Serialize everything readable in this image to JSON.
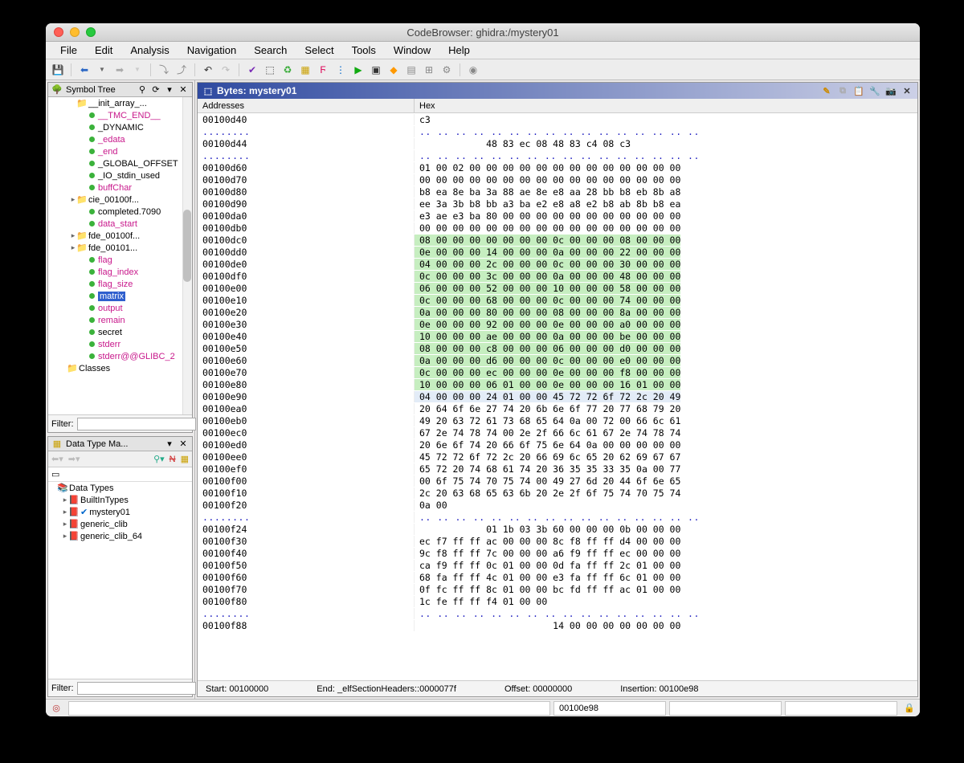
{
  "title": "CodeBrowser: ghidra:/mystery01",
  "menus": [
    "File",
    "Edit",
    "Analysis",
    "Navigation",
    "Search",
    "Select",
    "Tools",
    "Window",
    "Help"
  ],
  "symbol_tree": {
    "title": "Symbol Tree",
    "items": [
      {
        "type": "folder",
        "label": "__init_array_...",
        "indent": 2
      },
      {
        "type": "sym",
        "label": "__TMC_END__",
        "indent": 3,
        "style": "magenta"
      },
      {
        "type": "sym",
        "label": "_DYNAMIC",
        "indent": 3
      },
      {
        "type": "sym",
        "label": "_edata",
        "indent": 3,
        "style": "magenta"
      },
      {
        "type": "sym",
        "label": "_end",
        "indent": 3,
        "style": "magenta"
      },
      {
        "type": "sym",
        "label": "_GLOBAL_OFFSET",
        "indent": 3
      },
      {
        "type": "sym",
        "label": "_IO_stdin_used",
        "indent": 3
      },
      {
        "type": "sym",
        "label": "buffChar",
        "indent": 3,
        "style": "magenta"
      },
      {
        "type": "folder",
        "label": "cie_00100f...",
        "indent": 2,
        "exp": true
      },
      {
        "type": "sym",
        "label": "completed.7090",
        "indent": 3
      },
      {
        "type": "sym",
        "label": "data_start",
        "indent": 3,
        "style": "magenta"
      },
      {
        "type": "folder",
        "label": "fde_00100f...",
        "indent": 2,
        "exp": true
      },
      {
        "type": "folder",
        "label": "fde_00101...",
        "indent": 2,
        "exp": true
      },
      {
        "type": "sym",
        "label": "flag",
        "indent": 3,
        "style": "magenta"
      },
      {
        "type": "sym",
        "label": "flag_index",
        "indent": 3,
        "style": "magenta"
      },
      {
        "type": "sym",
        "label": "flag_size",
        "indent": 3,
        "style": "magenta"
      },
      {
        "type": "sym",
        "label": "matrix",
        "indent": 3,
        "selected": true
      },
      {
        "type": "sym",
        "label": "output",
        "indent": 3,
        "style": "magenta"
      },
      {
        "type": "sym",
        "label": "remain",
        "indent": 3,
        "style": "magenta"
      },
      {
        "type": "sym",
        "label": "secret",
        "indent": 3
      },
      {
        "type": "sym",
        "label": "stderr",
        "indent": 3,
        "style": "magenta"
      },
      {
        "type": "sym",
        "label": "stderr@@GLIBC_2",
        "indent": 3,
        "style": "magenta"
      },
      {
        "type": "classes",
        "label": "Classes",
        "indent": 1
      }
    ],
    "filter_label": "Filter:"
  },
  "data_type_mgr": {
    "title": "Data Type Ma...",
    "root": "Data Types",
    "nodes": [
      "BuiltInTypes",
      "mystery01",
      "generic_clib",
      "generic_clib_64"
    ],
    "filter_label": "Filter:"
  },
  "bytes": {
    "title": "Bytes: mystery01",
    "col_addr": "Addresses",
    "col_hex": "Hex",
    "rows": [
      {
        "addr": "00100d40",
        "hex": "c3"
      },
      {
        "dots": true
      },
      {
        "addr": "00100d44",
        "hex": "            48 83 ec 08 48 83 c4 08 c3"
      },
      {
        "dots": true
      },
      {
        "addr": "00100d60",
        "hex": "01 00 02 00 00 00 00 00 00 00 00 00 00 00 00 00"
      },
      {
        "addr": "00100d70",
        "hex": "00 00 00 00 00 00 00 00 00 00 00 00 00 00 00 00"
      },
      {
        "addr": "00100d80",
        "hex": "b8 ea 8e ba 3a 88 ae 8e e8 aa 28 bb b8 eb 8b a8"
      },
      {
        "addr": "00100d90",
        "hex": "ee 3a 3b b8 bb a3 ba e2 e8 a8 e2 b8 ab 8b b8 ea"
      },
      {
        "addr": "00100da0",
        "hex": "e3 ae e3 ba 80 00 00 00 00 00 00 00 00 00 00 00"
      },
      {
        "addr": "00100db0",
        "hex": "00 00 00 00 00 00 00 00 00 00 00 00 00 00 00 00"
      },
      {
        "addr": "00100dc0",
        "hex": "08 00 00 00 00 00 00 00 0c 00 00 00 08 00 00 00",
        "hl": "g"
      },
      {
        "addr": "00100dd0",
        "hex": "0e 00 00 00 14 00 00 00 0a 00 00 00 22 00 00 00",
        "hl": "g"
      },
      {
        "addr": "00100de0",
        "hex": "04 00 00 00 2c 00 00 00 0c 00 00 00 30 00 00 00",
        "hl": "g"
      },
      {
        "addr": "00100df0",
        "hex": "0c 00 00 00 3c 00 00 00 0a 00 00 00 48 00 00 00",
        "hl": "g"
      },
      {
        "addr": "00100e00",
        "hex": "06 00 00 00 52 00 00 00 10 00 00 00 58 00 00 00",
        "hl": "g"
      },
      {
        "addr": "00100e10",
        "hex": "0c 00 00 00 68 00 00 00 0c 00 00 00 74 00 00 00",
        "hl": "g"
      },
      {
        "addr": "00100e20",
        "hex": "0a 00 00 00 80 00 00 00 08 00 00 00 8a 00 00 00",
        "hl": "g"
      },
      {
        "addr": "00100e30",
        "hex": "0e 00 00 00 92 00 00 00 0e 00 00 00 a0 00 00 00",
        "hl": "g"
      },
      {
        "addr": "00100e40",
        "hex": "10 00 00 00 ae 00 00 00 0a 00 00 00 be 00 00 00",
        "hl": "g"
      },
      {
        "addr": "00100e50",
        "hex": "08 00 00 00 c8 00 00 00 06 00 00 00 d0 00 00 00",
        "hl": "g"
      },
      {
        "addr": "00100e60",
        "hex": "0a 00 00 00 d6 00 00 00 0c 00 00 00 e0 00 00 00",
        "hl": "g"
      },
      {
        "addr": "00100e70",
        "hex": "0c 00 00 00 ec 00 00 00 0e 00 00 00 f8 00 00 00",
        "hl": "g"
      },
      {
        "addr": "00100e80",
        "hex": "10 00 00 00 06 01 00 00 0e 00 00 00 16 01 00 00",
        "hl": "g"
      },
      {
        "addr": "00100e90",
        "hex": "04 00 00 00 24 01 00 00 45 72 72 6f 72 2c 20 49",
        "hl": "l"
      },
      {
        "addr": "00100ea0",
        "hex": "20 64 6f 6e 27 74 20 6b 6e 6f 77 20 77 68 79 20"
      },
      {
        "addr": "00100eb0",
        "hex": "49 20 63 72 61 73 68 65 64 0a 00 72 00 66 6c 61"
      },
      {
        "addr": "00100ec0",
        "hex": "67 2e 74 78 74 00 2e 2f 66 6c 61 67 2e 74 78 74"
      },
      {
        "addr": "00100ed0",
        "hex": "20 6e 6f 74 20 66 6f 75 6e 64 0a 00 00 00 00 00"
      },
      {
        "addr": "00100ee0",
        "hex": "45 72 72 6f 72 2c 20 66 69 6c 65 20 62 69 67 67"
      },
      {
        "addr": "00100ef0",
        "hex": "65 72 20 74 68 61 74 20 36 35 35 33 35 0a 00 77"
      },
      {
        "addr": "00100f00",
        "hex": "00 6f 75 74 70 75 74 00 49 27 6d 20 44 6f 6e 65"
      },
      {
        "addr": "00100f10",
        "hex": "2c 20 63 68 65 63 6b 20 2e 2f 6f 75 74 70 75 74"
      },
      {
        "addr": "00100f20",
        "hex": "0a 00"
      },
      {
        "dots": true
      },
      {
        "addr": "00100f24",
        "hex": "            01 1b 03 3b 60 00 00 00 0b 00 00 00"
      },
      {
        "addr": "00100f30",
        "hex": "ec f7 ff ff ac 00 00 00 8c f8 ff ff d4 00 00 00"
      },
      {
        "addr": "00100f40",
        "hex": "9c f8 ff ff 7c 00 00 00 a6 f9 ff ff ec 00 00 00"
      },
      {
        "addr": "00100f50",
        "hex": "ca f9 ff ff 0c 01 00 00 0d fa ff ff 2c 01 00 00"
      },
      {
        "addr": "00100f60",
        "hex": "68 fa ff ff 4c 01 00 00 e3 fa ff ff 6c 01 00 00"
      },
      {
        "addr": "00100f70",
        "hex": "0f fc ff ff 8c 01 00 00 bc fd ff ff ac 01 00 00"
      },
      {
        "addr": "00100f80",
        "hex": "1c fe ff ff f4 01 00 00"
      },
      {
        "dots": true
      },
      {
        "addr": "00100f88",
        "hex": "                        14 00 00 00 00 00 00 00"
      }
    ],
    "status": {
      "start": "Start: 00100000",
      "end": "End: _elfSectionHeaders::0000077f",
      "offset": "Offset: 00000000",
      "insertion": "Insertion: 00100e98"
    }
  },
  "app_status_addr": "00100e98"
}
